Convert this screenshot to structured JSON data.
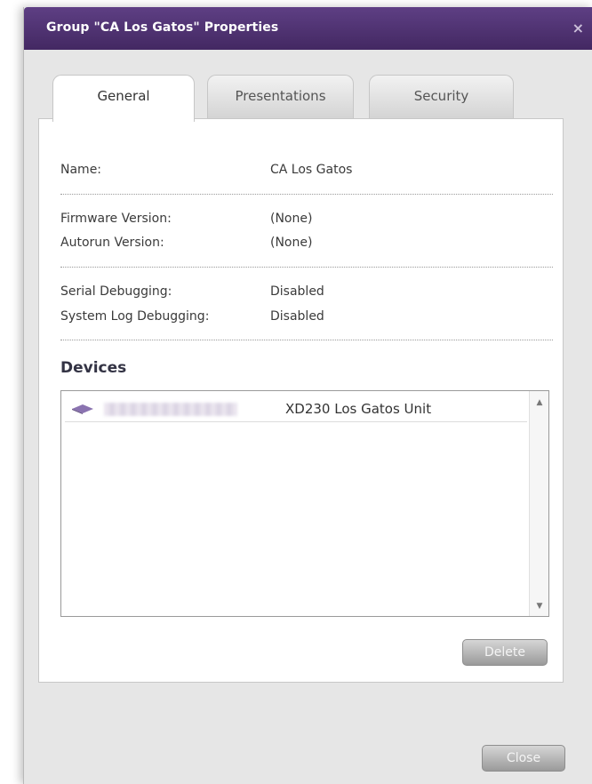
{
  "dialog": {
    "title": "Group \"CA Los Gatos\" Properties",
    "close_glyph": "×",
    "close_button_label": "Close"
  },
  "tabs": [
    {
      "label": "General",
      "active": true
    },
    {
      "label": "Presentations",
      "active": false
    },
    {
      "label": "Security",
      "active": false
    }
  ],
  "general": {
    "name_label": "Name:",
    "name_value": "CA Los Gatos",
    "firmware_label": "Firmware Version:",
    "firmware_value": "(None)",
    "autorun_label": "Autorun Version:",
    "autorun_value": "(None)",
    "serial_debug_label": "Serial Debugging:",
    "serial_debug_value": "Disabled",
    "syslog_debug_label": "System Log Debugging:",
    "syslog_debug_value": "Disabled"
  },
  "devices": {
    "heading": "Devices",
    "items": [
      {
        "icon": "device-icon",
        "name": "XD230 Los Gatos Unit"
      }
    ],
    "delete_label": "Delete"
  },
  "colors": {
    "titlebar": "#4d3270",
    "accent_text": "#333344"
  }
}
